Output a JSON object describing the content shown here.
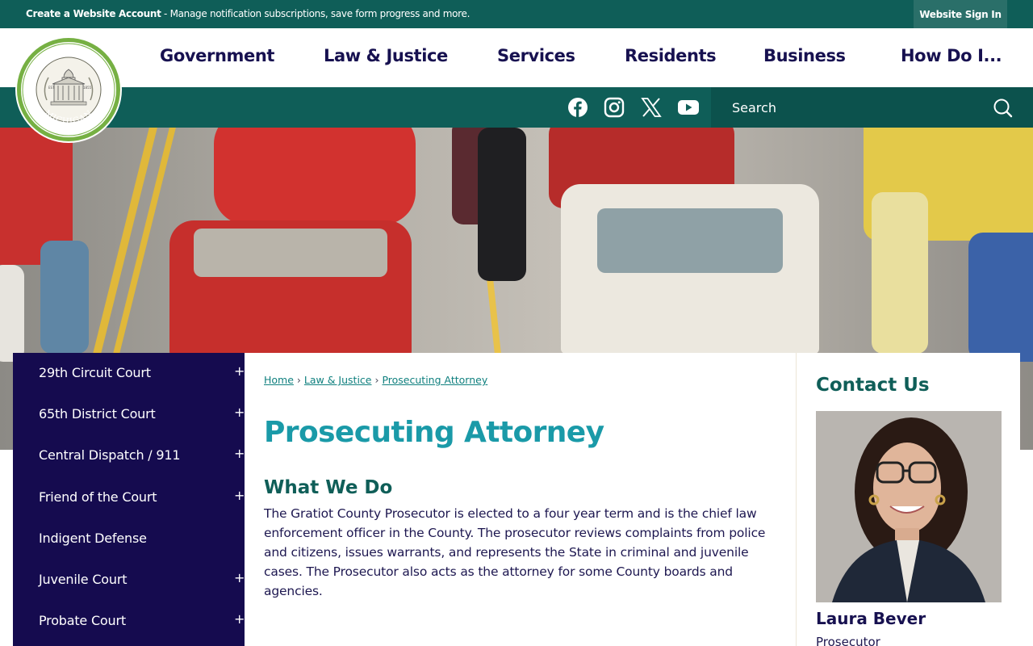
{
  "topbar": {
    "create_account_label": "Create a Website Account",
    "message": " - Manage notification subscriptions, save form progress and more.",
    "sign_in_label": "Website Sign In"
  },
  "logo": {
    "top_text": "GRATIOT COUNTY",
    "bottom_text": "MICHIGAN",
    "est_label": "EST.",
    "est_year": "1855"
  },
  "nav": {
    "items": [
      "Government",
      "Law & Justice",
      "Services",
      "Residents",
      "Business",
      "How Do I..."
    ]
  },
  "social": {
    "icons": [
      "facebook-icon",
      "instagram-icon",
      "x-icon",
      "youtube-icon"
    ]
  },
  "search": {
    "placeholder": "Search"
  },
  "sidebar": {
    "items": [
      {
        "label": "29th Circuit Court",
        "expandable": "+"
      },
      {
        "label": "65th District Court",
        "expandable": "+"
      },
      {
        "label": "Central Dispatch / 911",
        "expandable": "+"
      },
      {
        "label": "Friend of the Court",
        "expandable": "+"
      },
      {
        "label": "Indigent Defense",
        "expandable": ""
      },
      {
        "label": "Juvenile Court",
        "expandable": "+"
      },
      {
        "label": "Probate Court",
        "expandable": "+"
      }
    ]
  },
  "breadcrumb": {
    "items": [
      "Home",
      "Law & Justice",
      "Prosecuting Attorney"
    ],
    "separator": "›"
  },
  "main": {
    "title": "Prosecuting Attorney",
    "section_title": "What We Do",
    "body": "The Gratiot County Prosecutor is elected to a four year term and is the chief law enforcement officer in the County. The prosecutor reviews complaints from police and citizens, issues warrants, and represents the State in criminal and juvenile cases. The Prosecutor also acts as the attorney for some County boards and agencies."
  },
  "contact": {
    "title": "Contact Us",
    "name": "Laura Bever",
    "role": "Prosecutor"
  },
  "colors": {
    "brand_teal": "#0f5e58",
    "nav_navy": "#171150",
    "sidebar_navy": "#150b4f",
    "title_teal": "#1a9aa8",
    "logo_green": "#76b043"
  }
}
